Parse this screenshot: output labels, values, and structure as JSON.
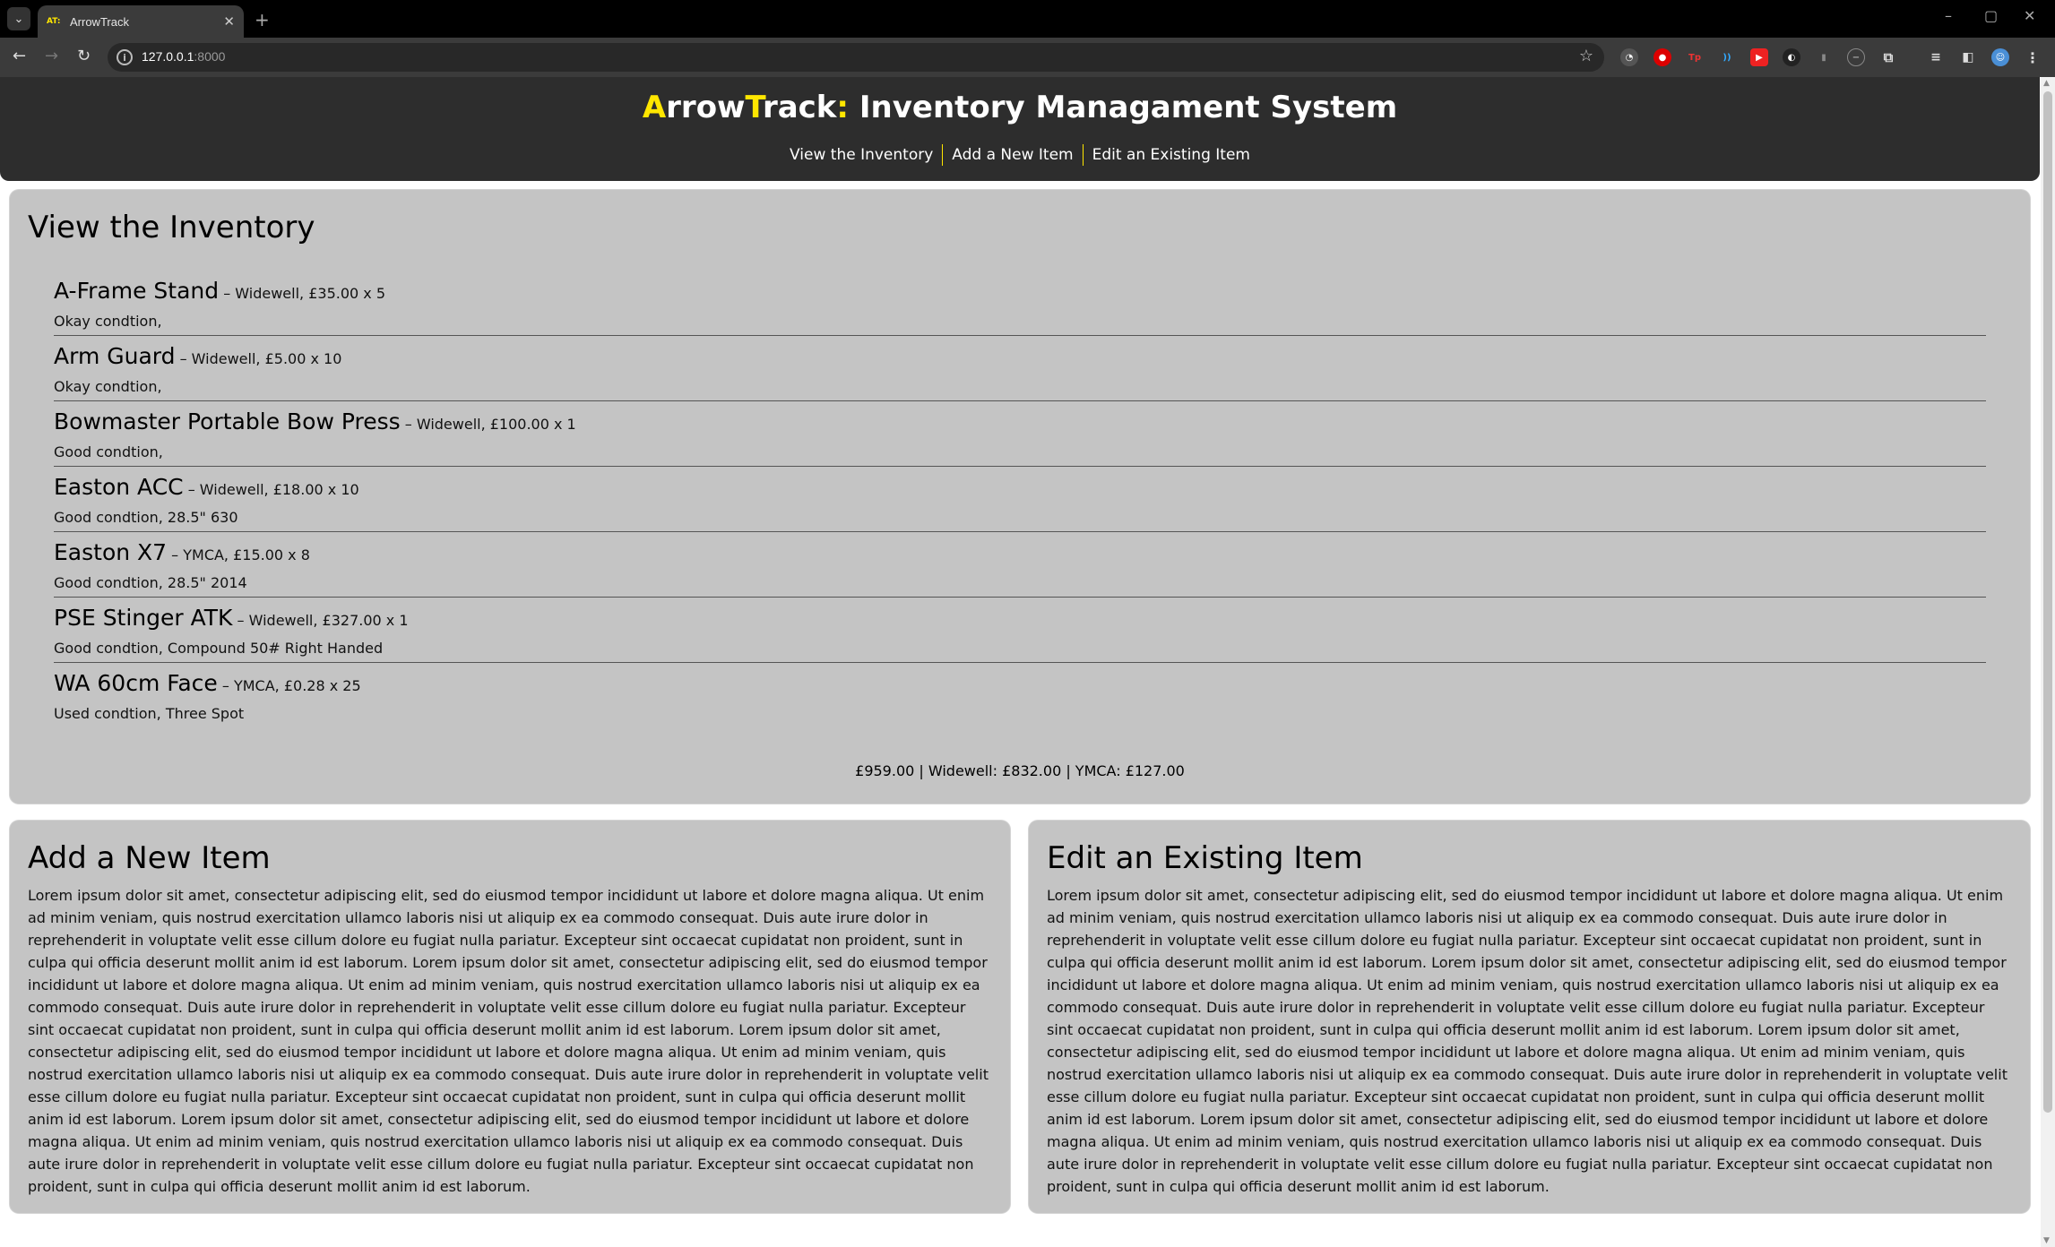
{
  "browser": {
    "tab_favicon": "AT:",
    "tab_title": "ArrowTrack",
    "url_host": "127.0.0.1",
    "url_port": ":8000",
    "window_controls": {
      "minimize": "–",
      "maximize": "▢",
      "close": "✕"
    }
  },
  "header": {
    "title_a": "A",
    "title_rrow": "rrow",
    "title_t": "T",
    "title_rack": "rack",
    "title_colon": ":",
    "title_rest": " Inventory Managament System",
    "nav": [
      "View the Inventory",
      "Add a New Item",
      "Edit an Existing Item"
    ]
  },
  "inventory": {
    "heading": "View the Inventory",
    "items": [
      {
        "name": "A-Frame Stand",
        "meta": " – Widewell, £35.00 x 5",
        "desc": "Okay condtion,"
      },
      {
        "name": "Arm Guard",
        "meta": " – Widewell, £5.00 x 10",
        "desc": "Okay condtion,"
      },
      {
        "name": "Bowmaster Portable Bow Press",
        "meta": " – Widewell, £100.00 x 1",
        "desc": "Good condtion,"
      },
      {
        "name": "Easton ACC",
        "meta": " – Widewell, £18.00 x 10",
        "desc": "Good condtion, 28.5\" 630"
      },
      {
        "name": "Easton X7",
        "meta": " – YMCA, £15.00 x 8",
        "desc": "Good condtion, 28.5\" 2014"
      },
      {
        "name": "PSE Stinger ATK",
        "meta": " – Widewell, £327.00 x 1",
        "desc": "Good condtion, Compound 50# Right Handed"
      },
      {
        "name": "WA 60cm Face",
        "meta": " – YMCA, £0.28 x 25",
        "desc": "Used condtion, Three Spot"
      }
    ],
    "totals": "£959.00 | Widewell: £832.00 | YMCA: £127.00"
  },
  "add_item": {
    "heading": "Add a New Item",
    "body": "Lorem ipsum dolor sit amet, consectetur adipiscing elit, sed do eiusmod tempor incididunt ut labore et dolore magna aliqua. Ut enim ad minim veniam, quis nostrud exercitation ullamco laboris nisi ut aliquip ex ea commodo consequat. Duis aute irure dolor in reprehenderit in voluptate velit esse cillum dolore eu fugiat nulla pariatur. Excepteur sint occaecat cupidatat non proident, sunt in culpa qui officia deserunt mollit anim id est laborum. Lorem ipsum dolor sit amet, consectetur adipiscing elit, sed do eiusmod tempor incididunt ut labore et dolore magna aliqua. Ut enim ad minim veniam, quis nostrud exercitation ullamco laboris nisi ut aliquip ex ea commodo consequat. Duis aute irure dolor in reprehenderit in voluptate velit esse cillum dolore eu fugiat nulla pariatur. Excepteur sint occaecat cupidatat non proident, sunt in culpa qui officia deserunt mollit anim id est laborum. Lorem ipsum dolor sit amet, consectetur adipiscing elit, sed do eiusmod tempor incididunt ut labore et dolore magna aliqua. Ut enim ad minim veniam, quis nostrud exercitation ullamco laboris nisi ut aliquip ex ea commodo consequat. Duis aute irure dolor in reprehenderit in voluptate velit esse cillum dolore eu fugiat nulla pariatur. Excepteur sint occaecat cupidatat non proident, sunt in culpa qui officia deserunt mollit anim id est laborum. Lorem ipsum dolor sit amet, consectetur adipiscing elit, sed do eiusmod tempor incididunt ut labore et dolore magna aliqua. Ut enim ad minim veniam, quis nostrud exercitation ullamco laboris nisi ut aliquip ex ea commodo consequat. Duis aute irure dolor in reprehenderit in voluptate velit esse cillum dolore eu fugiat nulla pariatur. Excepteur sint occaecat cupidatat non proident, sunt in culpa qui officia deserunt mollit anim id est laborum."
  },
  "edit_item": {
    "heading": "Edit an Existing Item",
    "body": "Lorem ipsum dolor sit amet, consectetur adipiscing elit, sed do eiusmod tempor incididunt ut labore et dolore magna aliqua. Ut enim ad minim veniam, quis nostrud exercitation ullamco laboris nisi ut aliquip ex ea commodo consequat. Duis aute irure dolor in reprehenderit in voluptate velit esse cillum dolore eu fugiat nulla pariatur. Excepteur sint occaecat cupidatat non proident, sunt in culpa qui officia deserunt mollit anim id est laborum. Lorem ipsum dolor sit amet, consectetur adipiscing elit, sed do eiusmod tempor incididunt ut labore et dolore magna aliqua. Ut enim ad minim veniam, quis nostrud exercitation ullamco laboris nisi ut aliquip ex ea commodo consequat. Duis aute irure dolor in reprehenderit in voluptate velit esse cillum dolore eu fugiat nulla pariatur. Excepteur sint occaecat cupidatat non proident, sunt in culpa qui officia deserunt mollit anim id est laborum. Lorem ipsum dolor sit amet, consectetur adipiscing elit, sed do eiusmod tempor incididunt ut labore et dolore magna aliqua. Ut enim ad minim veniam, quis nostrud exercitation ullamco laboris nisi ut aliquip ex ea commodo consequat. Duis aute irure dolor in reprehenderit in voluptate velit esse cillum dolore eu fugiat nulla pariatur. Excepteur sint occaecat cupidatat non proident, sunt in culpa qui officia deserunt mollit anim id est laborum. Lorem ipsum dolor sit amet, consectetur adipiscing elit, sed do eiusmod tempor incididunt ut labore et dolore magna aliqua. Ut enim ad minim veniam, quis nostrud exercitation ullamco laboris nisi ut aliquip ex ea commodo consequat. Duis aute irure dolor in reprehenderit in voluptate velit esse cillum dolore eu fugiat nulla pariatur. Excepteur sint occaecat cupidatat non proident, sunt in culpa qui officia deserunt mollit anim id est laborum."
  },
  "colors": {
    "header_bg": "#2d2d2d",
    "accent": "#ffe600",
    "card_bg": "#c4c4c4"
  }
}
